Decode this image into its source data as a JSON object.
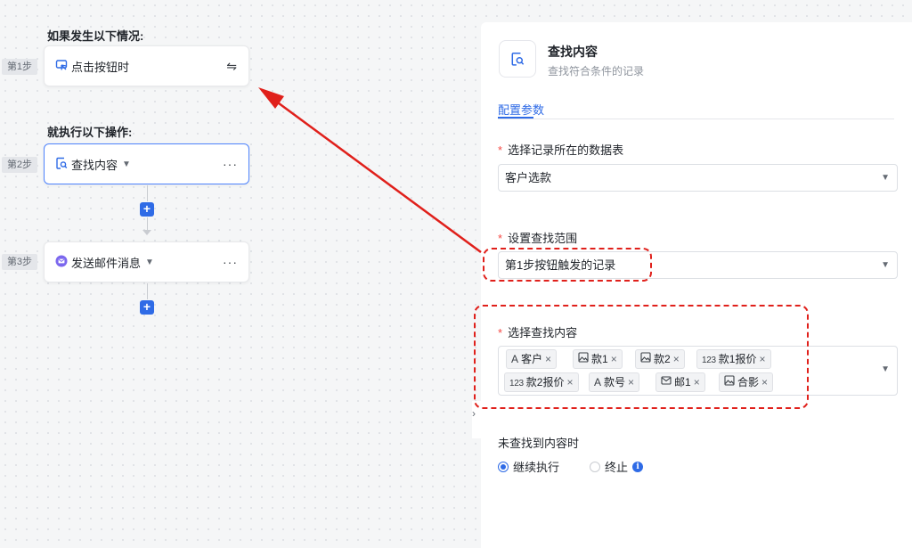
{
  "flow": {
    "trigger_title": "如果发生以下情况:",
    "action_title": "就执行以下操作:",
    "steps": [
      {
        "label": "第1步",
        "name": "点击按钮时",
        "icon": "cursor-click-icon",
        "more": "⇋"
      },
      {
        "label": "第2步",
        "name": "查找内容",
        "icon": "search-record-icon",
        "more": "···"
      },
      {
        "label": "第3步",
        "name": "发送邮件消息",
        "icon": "mail-icon",
        "more": "···"
      }
    ],
    "add_symbol": "+"
  },
  "panel": {
    "title": "查找内容",
    "subtitle": "查找符合条件的记录",
    "tab": "配置参数",
    "table_field": {
      "label": "选择记录所在的数据表",
      "value": "客户选款"
    },
    "scope_field": {
      "label": "设置查找范围",
      "value": "第1步按钮触发的记录"
    },
    "content_field": {
      "label": "选择查找内容",
      "tags": [
        {
          "icon": "text-type-icon",
          "glyph": "A",
          "text": "客户"
        },
        {
          "icon": "image-type-icon",
          "glyph": "",
          "text": "款1"
        },
        {
          "icon": "image-type-icon",
          "glyph": "",
          "text": "款2"
        },
        {
          "icon": "number-type-icon",
          "glyph": "123",
          "text": "款1报价"
        },
        {
          "icon": "number-type-icon",
          "glyph": "123",
          "text": "款2报价"
        },
        {
          "icon": "text-type-icon",
          "glyph": "A",
          "text": "款号"
        },
        {
          "icon": "email-type-icon",
          "glyph": "",
          "text": "邮1"
        },
        {
          "icon": "image-type-icon",
          "glyph": "",
          "text": "合影"
        }
      ]
    },
    "not_found": {
      "label": "未查找到内容时",
      "options": [
        {
          "label": "继续执行",
          "selected": true
        },
        {
          "label": "终止",
          "selected": false
        }
      ],
      "info": "i"
    },
    "required_mark": "*",
    "tag_remove": "×"
  },
  "colors": {
    "accent": "#2f6be6",
    "annotation": "#e0201b"
  }
}
